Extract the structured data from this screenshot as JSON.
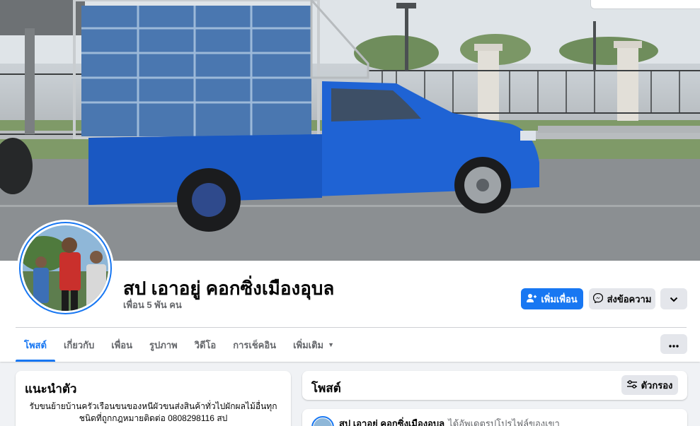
{
  "profile": {
    "name": "สป เอาอยู่ คอกซิ่งเมืองอุบล",
    "friends": "เพื่อน 5 พัน คน"
  },
  "actions": {
    "add_friend": "เพิ่มเพื่อน",
    "message": "ส่งข้อความ"
  },
  "tabs": [
    {
      "label": "โพสต์",
      "active": true
    },
    {
      "label": "เกี่ยวกับ"
    },
    {
      "label": "เพื่อน"
    },
    {
      "label": "รูปภาพ"
    },
    {
      "label": "วิดีโอ"
    },
    {
      "label": "การเช็คอิน"
    },
    {
      "label": "เพิ่มเติม"
    }
  ],
  "intro": {
    "title": "แนะนำตัว",
    "bio": "รับขนย้ายบ้านครัวเรือนขนของหนีผัวขนส่งสินค้าทั่วไปผักผลไม้อื่นทุกชนิดที่ถูกกฎหมายติดต่อ 0808298116 สป"
  },
  "posts": {
    "title": "โพสต์",
    "filter_label": "ตัวกรอง",
    "first_post": {
      "author": "สป เอาอยู่ คอกซิ่งเมืองอุบล",
      "action": "ได้อัพเดตรูปโปรไฟล์ของเขา"
    }
  },
  "colors": {
    "accent": "#1877f2",
    "page_bg": "#f0f2f5",
    "secondary_button": "#e4e6eb",
    "truck_blue": "#1a5fd0"
  }
}
